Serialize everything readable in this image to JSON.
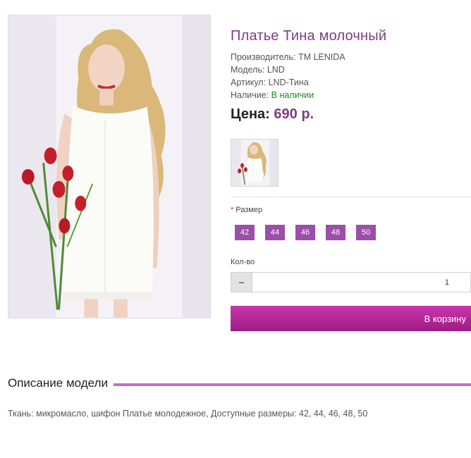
{
  "product": {
    "title": "Платье Тина молочный",
    "manufacturer_label": "Производитель:",
    "manufacturer": "TM LENIDA",
    "model_label": "Модель:",
    "model": "LND",
    "sku_label": "Артикул:",
    "sku": "LND-Тина",
    "availability_label": "Наличие:",
    "availability": "В наличии",
    "price_label": "Цена:",
    "price": "690 р."
  },
  "options": {
    "size_required_mark": "*",
    "size_label": "Размер",
    "sizes": [
      "42",
      "44",
      "46",
      "48",
      "50"
    ]
  },
  "quantity": {
    "label": "Кол-во",
    "minus_symbol": "−",
    "value": "1"
  },
  "cart": {
    "button_label": "В корзину"
  },
  "description": {
    "title": "Описание модели",
    "text": "Ткань: микромасло, шифон Платье молодежное, Доступные размеры: 42, 44, 46, 48, 50"
  },
  "colors": {
    "accent": "#7d3d86",
    "size_button": "#9b4fa9",
    "cart_button": "#b42a9a",
    "in_stock": "#178a17"
  }
}
